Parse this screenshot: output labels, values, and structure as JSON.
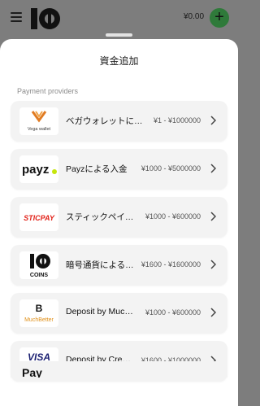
{
  "header": {
    "balance": "¥0.00",
    "logo_alt": "10bet"
  },
  "sheet": {
    "title": "資金追加",
    "section_label": "Payment providers"
  },
  "providers": [
    {
      "name": "ベガウォレットに…",
      "range": "¥1 - ¥1000000",
      "logo_text": "Vega wallet",
      "logo_kind": "vega"
    },
    {
      "name": "Payzによる入金",
      "range": "¥1000 - ¥5000000",
      "logo_text": "payz",
      "logo_kind": "payz"
    },
    {
      "name": "スティックペイ…",
      "range": "¥1000 - ¥600000",
      "logo_text": "STICPAY",
      "logo_kind": "sticpay"
    },
    {
      "name": "暗号通貨による…",
      "range": "¥1600 - ¥1600000",
      "logo_text": "COINS",
      "logo_kind": "coins"
    },
    {
      "name": "Deposit by Muc…",
      "range": "¥1000 - ¥600000",
      "logo_text": "MuchBetter",
      "logo_kind": "muchbetter"
    },
    {
      "name": "Deposit by Cre…",
      "range": "¥1600 - ¥1000000",
      "logo_text": "VISA",
      "logo_kind": "visa"
    }
  ],
  "partial_item": {
    "logo_text": "Pay"
  },
  "colors": {
    "accent": "#2f7a3a",
    "sheet_bg": "#ffffff",
    "row_bg": "#f3f3f3"
  }
}
